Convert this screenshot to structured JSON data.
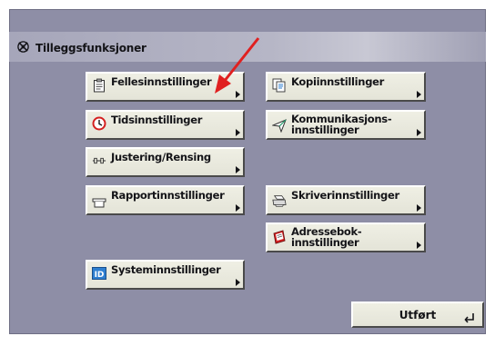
{
  "screen": {
    "title": "Tilleggsfunksjoner",
    "title_icon": "gear-cross-icon"
  },
  "buttons": {
    "felles": {
      "label": "Fellesinnstillinger",
      "icon": "clipboard-icon"
    },
    "kopi": {
      "label": "Kopiinnstillinger",
      "icon": "copy-pages-icon"
    },
    "tids": {
      "label": "Tidsinnstillinger",
      "icon": "clock-icon"
    },
    "kommunikasjon": {
      "label": "Kommunikasjons-\ninnstillinger",
      "icon": "send-arrow-icon"
    },
    "justering": {
      "label": "Justering/Rensing",
      "icon": "adjust-slider-icon"
    },
    "rapport": {
      "label": "Rapportinnstillinger",
      "icon": "tray-icon"
    },
    "skriver": {
      "label": "Skriverinnstillinger",
      "icon": "printer-icon"
    },
    "adressebok": {
      "label": "Adressebok-\ninnstillinger",
      "icon": "address-book-icon"
    },
    "system": {
      "label": "Systeminnstillinger",
      "icon": "id-icon"
    }
  },
  "done": {
    "label": "Utført",
    "icon": "enter-return-icon"
  },
  "annotation": {
    "type": "red-arrow",
    "color": "#e02020"
  },
  "colors": {
    "panel": "#8e8ea6",
    "button_face": "#ebebe0",
    "clock_red": "#d42020",
    "id_blue": "#2f7fd0",
    "arrow_red": "#e02020"
  }
}
